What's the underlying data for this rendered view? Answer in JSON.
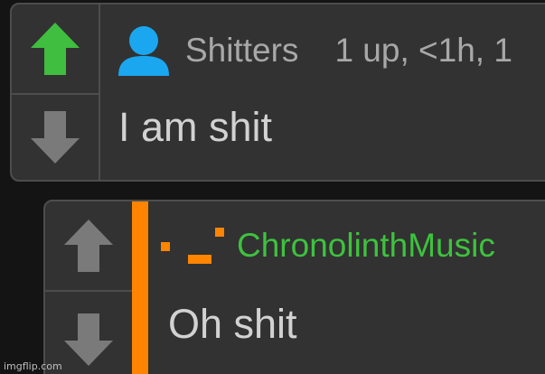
{
  "comments": [
    {
      "username": "Shitters",
      "meta": "1 up, <1h, 1",
      "text": "I am shit",
      "upvoted": true,
      "avatar_icon": "user-avatar-icon",
      "username_color": "#a8a8a8",
      "upvote_color": "#3fbe3f"
    },
    {
      "username": "ChronolinthMusic",
      "text": "Oh shit",
      "upvoted": false,
      "avatar_icon": "pixel-logo-icon",
      "username_color": "#3ec23e",
      "thread_bar_color": "#ff8400"
    }
  ],
  "watermark": "imgflip.com"
}
